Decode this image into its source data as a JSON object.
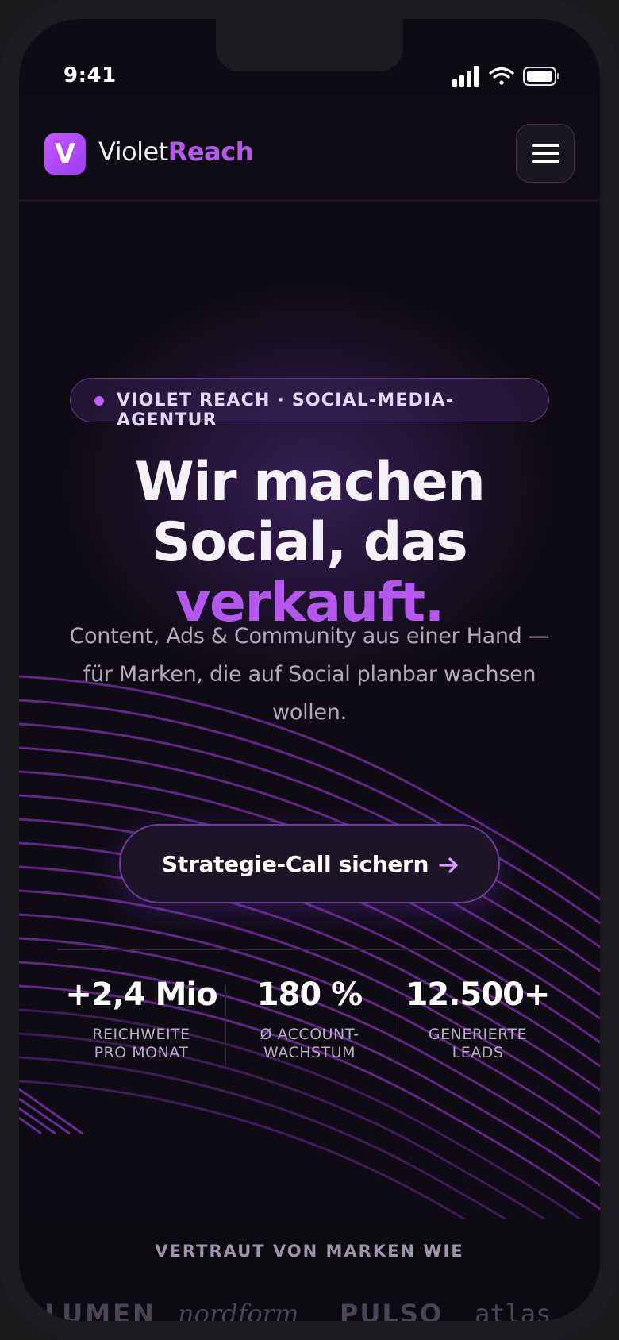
{
  "status_bar": {
    "time": "9:41"
  },
  "brand": {
    "mark": "V",
    "name_plain": "Violet",
    "name_accent": "Reach"
  },
  "nav": {
    "menu_icon": "hamburger-menu-icon"
  },
  "hero": {
    "badge": "VIOLET REACH · SOCIAL-MEDIA-AGENTUR",
    "headline_line1": "Wir machen",
    "headline_line2": "Social, das",
    "headline_accent": "verkauft.",
    "subline": "Content, Ads & Community aus einer Hand — für Marken, die auf Social planbar wachsen wollen.",
    "cta_label": "Strategie-Call sichern",
    "cta_icon": "arrow-right-icon"
  },
  "stats": [
    {
      "value": "+2,4 Mio",
      "label_line1": "REICHWEITE",
      "label_line2": "PRO MONAT"
    },
    {
      "value": "180 %",
      "label_line1": "Ø ACCOUNT-",
      "label_line2": "WACHSTUM"
    },
    {
      "value": "12.500+",
      "label_line1": "GENERIERTE",
      "label_line2": "LEADS"
    }
  ],
  "trusted": {
    "title": "VERTRAUT VON MARKEN WIE",
    "logos": [
      "LUMEN",
      "nordform",
      "PULSO",
      "atlas"
    ]
  },
  "colors": {
    "accent": "#b457ef",
    "background": "#0e0b14",
    "badge_dot": "#c064ff"
  }
}
